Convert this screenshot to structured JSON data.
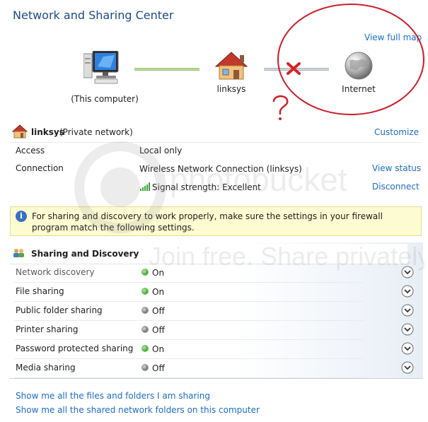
{
  "title": "Network and Sharing Center",
  "view_full_map": "View full map",
  "map": {
    "computer_label": "(This computer)",
    "router_label": "linksys",
    "internet_label": "Internet"
  },
  "network": {
    "name": "linksys",
    "type": "(Private network)",
    "customize": "Customize",
    "access_label": "Access",
    "access_value": "Local only",
    "connection_label": "Connection",
    "connection_value": "Wireless Network Connection (linksys)",
    "view_status": "View status",
    "signal_text": "Signal strength:  Excellent",
    "disconnect": "Disconnect"
  },
  "info_text": "For sharing and discovery to work properly, make sure the settings in your firewall program match the following settings.",
  "sharing": {
    "title": "Sharing and Discovery",
    "rows": [
      {
        "label": "Network discovery",
        "state": "On"
      },
      {
        "label": "File sharing",
        "state": "On"
      },
      {
        "label": "Public folder sharing",
        "state": "Off"
      },
      {
        "label": "Printer sharing",
        "state": "Off"
      },
      {
        "label": "Password protected sharing",
        "state": "On"
      },
      {
        "label": "Media sharing",
        "state": "Off"
      }
    ]
  },
  "links": {
    "files": "Show me all the files and folders I am sharing",
    "folders": "Show me all the shared network folders on this computer"
  },
  "watermark": "Join free. Share privately.",
  "colors": {
    "link": "#1c6cc4",
    "title": "#1d4a86",
    "annotation_red": "#cc1f2a",
    "info_bar": "#fcfbd1"
  }
}
